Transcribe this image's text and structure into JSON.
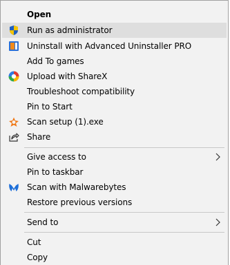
{
  "menu": {
    "items": [
      {
        "label": "Open",
        "icon": "",
        "bold": true
      },
      {
        "label": "Run as administrator",
        "icon": "uac-shield-icon",
        "highlighted": true
      },
      {
        "label": "Uninstall with Advanced Uninstaller PRO",
        "icon": "advanced-uninstaller-icon"
      },
      {
        "label": "Add To games",
        "icon": ""
      },
      {
        "label": "Upload with ShareX",
        "icon": "sharex-icon"
      },
      {
        "label": "Troubleshoot compatibility",
        "icon": ""
      },
      {
        "label": "Pin to Start",
        "icon": ""
      },
      {
        "label": "Scan setup (1).exe",
        "icon": "avast-icon"
      },
      {
        "label": "Share",
        "icon": "share-icon"
      },
      {
        "label": "Give access to",
        "icon": "",
        "submenu": true
      },
      {
        "label": "Pin to taskbar",
        "icon": ""
      },
      {
        "label": "Scan with Malwarebytes",
        "icon": "malwarebytes-icon"
      },
      {
        "label": "Restore previous versions",
        "icon": ""
      },
      {
        "label": "Send to",
        "icon": "",
        "submenu": true
      },
      {
        "label": "Cut",
        "icon": ""
      },
      {
        "label": "Copy",
        "icon": ""
      }
    ]
  },
  "colors": {
    "menu_background": "#f2f2f2",
    "highlight": "#dedede",
    "separator": "#c8c8c8",
    "shield_blue": "#1f5fbf",
    "shield_yellow": "#f5c400",
    "avast_orange": "#f07a19",
    "malwarebytes_blue": "#1e6fd9"
  }
}
